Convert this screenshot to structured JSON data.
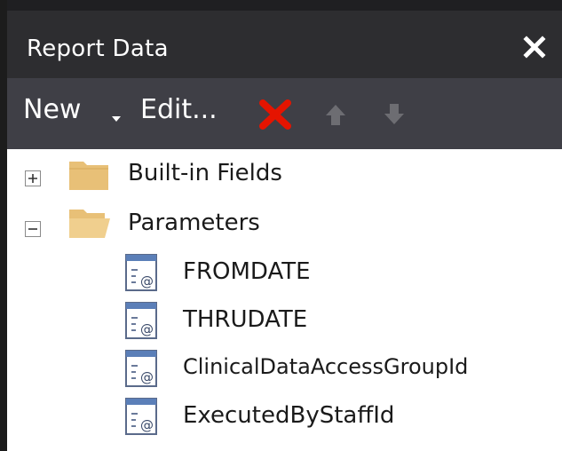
{
  "window": {
    "title": "Report Data"
  },
  "toolbar": {
    "new_label": "New",
    "edit_label": "Edit...",
    "delete_icon": "red-x-delete-icon",
    "up_icon": "move-up-arrow-icon",
    "down_icon": "move-down-arrow-icon"
  },
  "tree": {
    "builtin_fields": {
      "label": "Built-in Fields",
      "expander": "+",
      "expanded": false
    },
    "parameters": {
      "label": "Parameters",
      "expander": "−",
      "expanded": true,
      "items": [
        {
          "label": "FROMDATE"
        },
        {
          "label": "THRUDATE"
        },
        {
          "label": "ClinicalDataAccessGroupId"
        },
        {
          "label": "ExecutedByStaffId"
        }
      ]
    }
  },
  "colors": {
    "title_bar": "#2d2d30",
    "toolbar": "#3f3f46",
    "delete_red": "#e51400",
    "folder": "#e8c077"
  }
}
